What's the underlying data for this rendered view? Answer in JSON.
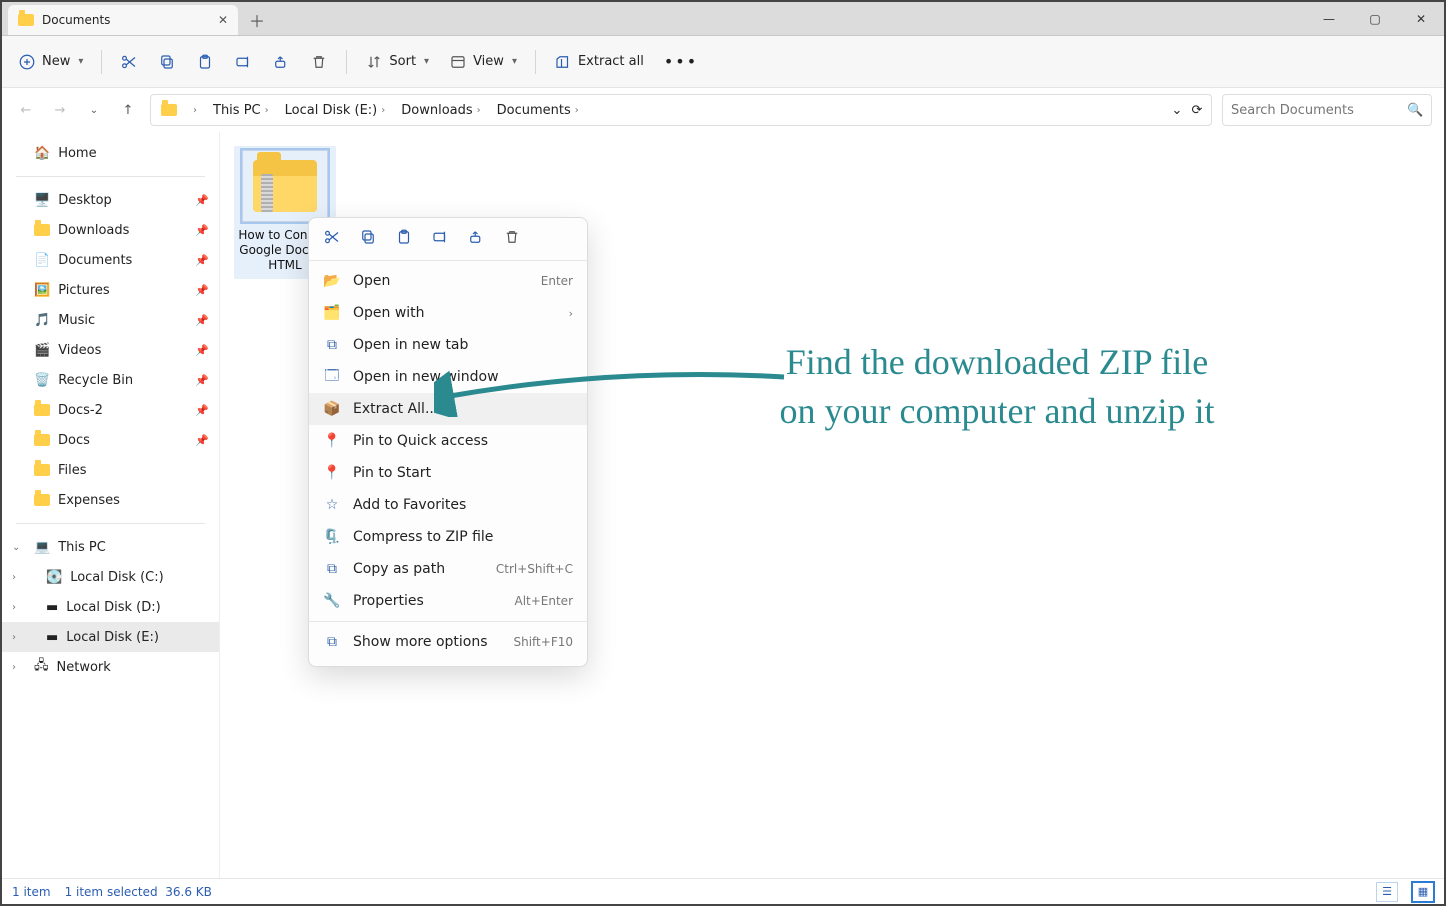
{
  "window": {
    "tab_title": "Documents",
    "minimize": "—",
    "maximize": "▢",
    "close": "✕"
  },
  "toolbar": {
    "new_label": "New",
    "sort_label": "Sort",
    "view_label": "View",
    "extract_all_label": "Extract all",
    "more": "…"
  },
  "breadcrumb": {
    "segments": [
      "This PC",
      "Local Disk (E:)",
      "Downloads",
      "Documents"
    ]
  },
  "search": {
    "placeholder": "Search Documents"
  },
  "sidebar": {
    "home": "Home",
    "quick": [
      {
        "label": "Desktop",
        "icon": "desktop-icon"
      },
      {
        "label": "Downloads",
        "icon": "folder-icon"
      },
      {
        "label": "Documents",
        "icon": "documents-icon"
      },
      {
        "label": "Pictures",
        "icon": "pictures-icon"
      },
      {
        "label": "Music",
        "icon": "music-icon"
      },
      {
        "label": "Videos",
        "icon": "videos-icon"
      },
      {
        "label": "Recycle Bin",
        "icon": "recyclebin-icon"
      },
      {
        "label": "Docs-2",
        "icon": "folder-icon"
      },
      {
        "label": "Docs",
        "icon": "folder-icon"
      },
      {
        "label": "Files",
        "icon": "folder-icon"
      },
      {
        "label": "Expenses",
        "icon": "folder-icon"
      }
    ],
    "tree": {
      "this_pc": "This PC",
      "drives": [
        "Local Disk (C:)",
        "Local Disk (D:)",
        "Local Disk (E:)"
      ],
      "network": "Network"
    }
  },
  "content": {
    "items": [
      {
        "name_line1": "How to Convert",
        "name_line2": "Google Docs to",
        "name_line3": "HTML",
        "type": "zip",
        "selected": true
      }
    ]
  },
  "context_menu": {
    "open": "Open",
    "open_sc": "Enter",
    "open_with": "Open with",
    "open_tab": "Open in new tab",
    "open_window": "Open in new window",
    "extract_all": "Extract All...",
    "pin_qa": "Pin to Quick access",
    "pin_start": "Pin to Start",
    "favorites": "Add to Favorites",
    "compress": "Compress to ZIP file",
    "copy_path": "Copy as path",
    "copy_path_sc": "Ctrl+Shift+C",
    "properties": "Properties",
    "properties_sc": "Alt+Enter",
    "more": "Show more options",
    "more_sc": "Shift+F10"
  },
  "status": {
    "count": "1 item",
    "selected": "1 item selected",
    "size": "36.6 KB"
  },
  "annotation": "Find the downloaded ZIP file on your computer and unzip it",
  "colors": {
    "accent": "#2a8a8f"
  }
}
